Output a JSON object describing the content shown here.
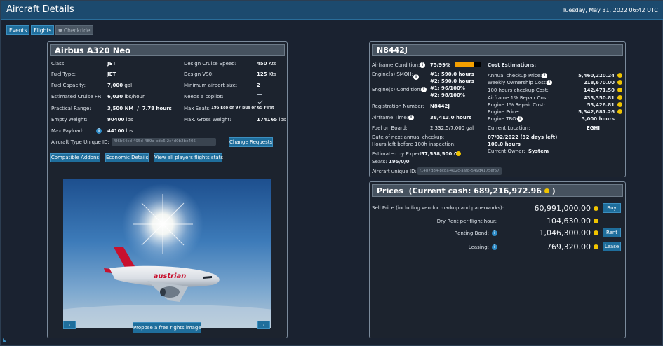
{
  "window": {
    "title": "Aircraft Details",
    "datetime": "Tuesday, May 31, 2022 06:42 UTC"
  },
  "tabs": {
    "events": "Events",
    "flights": "Flights",
    "checkride": "Checkride"
  },
  "aircraft": {
    "title": "Airbus A320 Neo",
    "class_label": "Class:",
    "class_value": "JET",
    "fuel_type_label": "Fuel Type:",
    "fuel_type_value": "JET",
    "fuel_capacity_label": "Fuel Capacity:",
    "fuel_capacity_value": "7,000",
    "fuel_capacity_unit": "gal",
    "cruise_ff_label": "Estimated Cruise FF:",
    "cruise_ff_value": "6,030",
    "cruise_ff_unit": "lbs/hour",
    "range_label": "Practical Range:",
    "range_value": "3,500 NM",
    "range_sep": "/",
    "range_hours": "7.78 hours",
    "empty_weight_label": "Empty Weight:",
    "empty_weight_value": "90400",
    "empty_weight_unit": "lbs",
    "max_payload_label": "Max Payload:",
    "max_payload_value": "44100",
    "max_payload_unit": "lbs",
    "cruise_speed_label": "Design Cruise Speed:",
    "cruise_speed_value": "450",
    "cruise_speed_unit": "Kts",
    "vs0_label": "Design VS0:",
    "vs0_value": "125",
    "vs0_unit": "Kts",
    "min_airport_label": "Minimum airport size:",
    "min_airport_value": "2",
    "copilot_label": "Needs a copilot:",
    "max_seats_label": "Max Seats:",
    "max_seats_value": "195 Eco or 97 Bus or 65 First",
    "max_gross_label": "Max. Gross Weight:",
    "max_gross_value": "174165",
    "max_gross_unit": "lbs",
    "type_uid_label": "Aircraft Type Unique ID:",
    "type_uid_value": "f86b64cd-495d-489a-bde6-2c4d0b2be405",
    "change_requests": "Change Requests",
    "compatible_addons": "Compatible Addons",
    "economic_details": "Economic Details",
    "all_flights": "View all players flights stats",
    "propose_image": "Propose a free rights image",
    "livery_text": "austrian"
  },
  "registration": {
    "title": "N8442J",
    "condition_label": "Airframe Condition:",
    "condition_value": "75/99%",
    "condition_fraction": 0.75,
    "smoh_label": "Engine(s) SMOH:",
    "smoh_1": "#1: 590.0 hours",
    "smoh_2": "#2: 590.0 hours",
    "engine_cond_label": "Engine(s) Condition:",
    "engine_cond_1": "#1: 96/100%",
    "engine_cond_2": "#2: 98/100%",
    "reg_label": "Registration Number:",
    "reg_value": "N8442J",
    "airframe_time_label": "Airframe Time:",
    "airframe_time_value": "38,413.0 hours",
    "fuel_label": "Fuel on Board:",
    "fuel_value": "2,332.5/7,000 gal",
    "next_check_label": "Date of next annual checkup:",
    "next_check_value": "07/02/2022 (32 days left)",
    "hours_100_label": "Hours left before 100h inspection:",
    "hours_100_value": "100.0 hours",
    "expert_label": "Estimated by Expert:",
    "expert_value": "57,538,500.00",
    "seats_label": "Seats:",
    "seats_value": "195/0/0",
    "uid_label": "Aircraft unique ID:",
    "uid_value": "f1487d84-8c8a-402c-aafb-549d4175ef57",
    "cost_title": "Cost Estimations:",
    "costs": [
      {
        "label": "Annual checkup Price:",
        "value": "5,460,220.24"
      },
      {
        "label": "Weekly Ownership Cost:",
        "value": "218,670.00"
      },
      {
        "label": "100 hours checkup Cost:",
        "value": "142,471.50"
      },
      {
        "label": "Airframe 1% Repair Cost:",
        "value": "433,350.81"
      },
      {
        "label": "Engine 1% Repair Cost:",
        "value": "53,426.81"
      },
      {
        "label": "Engine Price:",
        "value": "5,342,681.26"
      },
      {
        "label": "Engine TBO:",
        "value": "3,000 hours"
      }
    ],
    "location_label": "Current Location:",
    "location_value": "EGHI",
    "owner_label": "Current Owner:",
    "owner_value": "System"
  },
  "prices": {
    "title": "Prices",
    "cash_label": "(Current cash:",
    "cash_value": "689,216,972.96",
    "cash_close": ")",
    "sell_label": "Sell Price (including vendor markup and paperworks):",
    "sell_value": "60,991,000.00",
    "buy": "Buy",
    "dry_rent_label": "Dry Rent per flight hour:",
    "dry_rent_value": "104,630.00",
    "bond_label": "Renting Bond:",
    "bond_value": "1,046,300.00",
    "rent": "Rent",
    "leasing_label": "Leasing:",
    "leasing_value": "769,320.00",
    "lease": "Lease"
  },
  "colors": {
    "accent": "#1f6e9c",
    "coin": "#f0c400",
    "condition_bar": "#f5a000"
  }
}
